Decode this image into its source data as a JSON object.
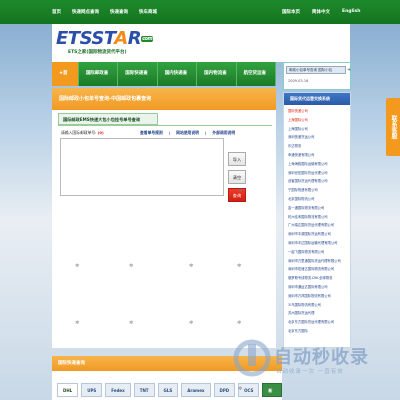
{
  "topbar": {
    "nav": [
      "首页",
      "快递网点查询",
      "快递查询",
      "快车商城"
    ],
    "right": [
      "国际本页",
      "简体中文",
      "English"
    ]
  },
  "logo": {
    "main_prefix": "ETSST",
    "main_accent": "A",
    "main_suffix": "R",
    "badge": "com",
    "sub": "ETS之家(国际物流货代平台)"
  },
  "mainnav": [
    "★首页",
    "国际邮政查询",
    "国际快递查询",
    "国内快递查询",
    "国内物流查询",
    "航空货运查询"
  ],
  "loginbox": {
    "track_label": "邮政小包单号查询  国际小包",
    "date": "2009-03-16"
  },
  "leftpanel": {
    "title": "国际邮政小包单号查询-中国邮政包裹查询",
    "subtab": "国际邮政EMS快递大包小包挂号单号查询",
    "input_label": "请输入国际邮政单号:",
    "input_count": "(0)",
    "links": [
      "查看单号规则",
      "网站使用说明",
      "外部调用说明"
    ],
    "buttons": {
      "import": "导入",
      "clear": "清空",
      "query": "查询"
    }
  },
  "rightpanel": {
    "title": "国际货代运营交换系统",
    "items": [
      {
        "text": "国际快递公司",
        "red": true
      },
      {
        "text": "上海国际公司",
        "red": true
      },
      {
        "text": "上海国际公司",
        "red": false
      },
      {
        "text": "深圳快递货运公司",
        "red": false
      },
      {
        "text": "乐达物流",
        "red": false
      },
      {
        "text": "申通快递有限公司",
        "red": false
      },
      {
        "text": "上海海韵国际运输有限公司",
        "red": false
      },
      {
        "text": "深圳世宏国际货运代理公司",
        "red": false
      },
      {
        "text": "创客国际货运代理有限公司",
        "red": false
      },
      {
        "text": "宁国际快递有限公司",
        "red": false
      },
      {
        "text": "北京国际物流公司",
        "red": false
      },
      {
        "text": "金一通国际物流有限公司",
        "red": false
      },
      {
        "text": "杭州佳禾国际物流有限公司",
        "red": false
      },
      {
        "text": "广州瑞达国际货运代理有限公司",
        "red": false
      },
      {
        "text": "深圳市丰源国际货运有限公司",
        "red": false
      },
      {
        "text": "深圳市丰达国际运输代理有限公司",
        "red": false
      },
      {
        "text": "一起飞国际物流有限公司",
        "red": false
      },
      {
        "text": "深圳市万里通国际货运代理有限公司",
        "red": false
      },
      {
        "text": "深圳市宏速达国际物流有限公司",
        "red": false
      },
      {
        "text": "俄罗斯专线物流-DHL全球物流",
        "red": false
      },
      {
        "text": "深圳市通运达国际有限公司",
        "red": false
      },
      {
        "text": "深圳市万邦国际物流有限公司",
        "red": false
      },
      {
        "text": "义乌国际物流有限公司",
        "red": false
      },
      {
        "text": "苏州国际货运代理",
        "red": false
      },
      {
        "text": "北京东方国际货运代理有限公司",
        "red": false
      },
      {
        "text": "北京东方国际",
        "red": false
      }
    ]
  },
  "bottompanel": {
    "title": "国际快递查询",
    "tabs": [
      "DHL",
      "UPS",
      "Fedex",
      "TNT",
      "GLS",
      "Aramex",
      "DPD",
      "OCS"
    ],
    "more": "新注册网站"
  },
  "side_float": "联系客服",
  "watermark": {
    "title": "自动秒收录",
    "sub": "自动收录一次 一直有效"
  }
}
